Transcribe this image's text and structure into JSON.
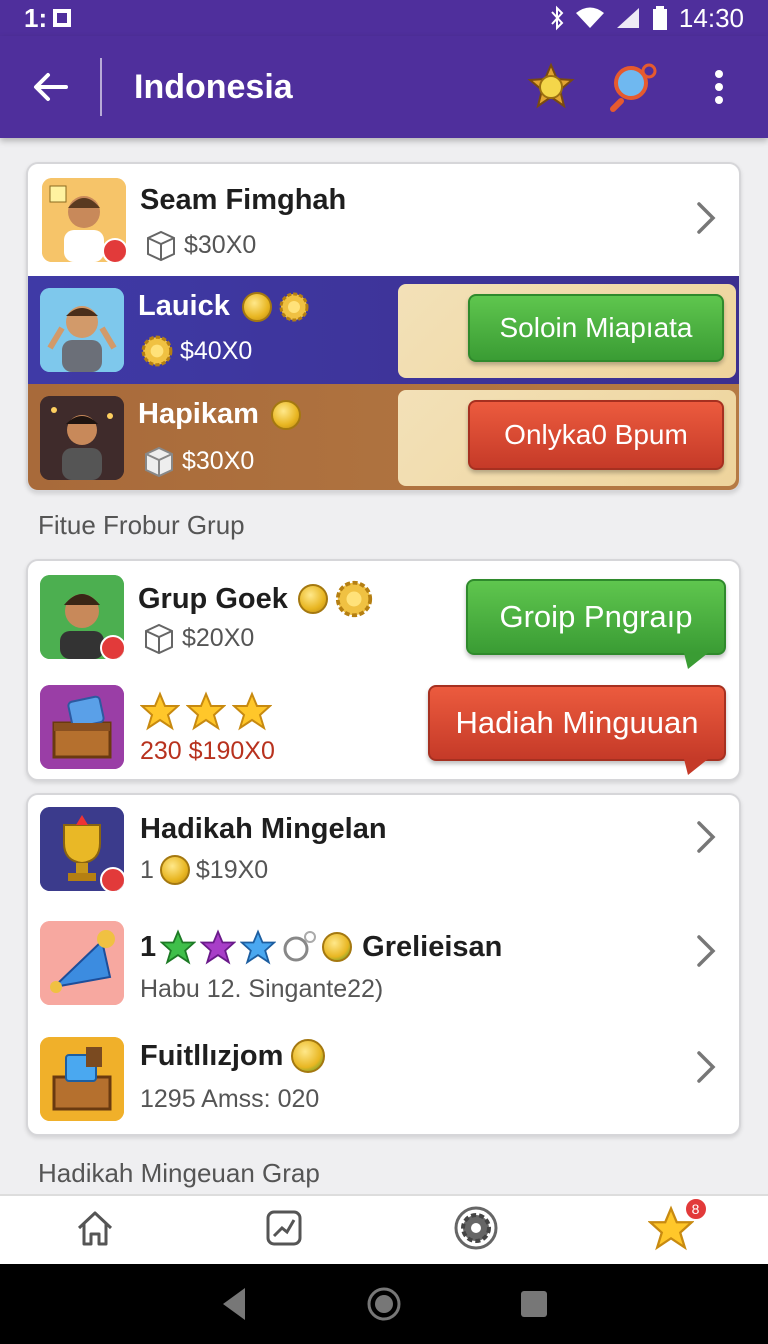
{
  "status_bar": {
    "time_left": "1:",
    "clock": "14:30"
  },
  "app_bar": {
    "title": "Indonesia"
  },
  "card1": {
    "rows": [
      {
        "name": "Seam Fimghah",
        "amount": "$30X0"
      },
      {
        "name": "Lauick",
        "amount": "$40X0",
        "button": "Soloin Miapıata"
      },
      {
        "name": "Hapikam",
        "amount": "$30X0",
        "button": "Onlyka0 Bpum"
      }
    ]
  },
  "section1": "Fitue Frobur Grup",
  "card2": {
    "rows": [
      {
        "name": "Grup Goek",
        "amount": "$20X0",
        "button": "Groip Pngraıp"
      },
      {
        "amount": "230 $190X0",
        "button": "Hadiah Minguuan"
      }
    ]
  },
  "card3": {
    "rows": [
      {
        "name": "Hadikah Mingelan",
        "amount": "$19X0",
        "prefix": "1"
      },
      {
        "prefix": "1",
        "name": "Grelieisan",
        "sub": "Habu 12. Singante22)"
      },
      {
        "name": "Fuitllızjom",
        "sub": "1295 Amss: 020"
      }
    ]
  },
  "section2": "Hadikah Mingeuan Grap",
  "bottom_nav": {
    "badge": "8"
  },
  "colors": {
    "primary": "#4f2f9c",
    "green": "#3a9c34",
    "red": "#c53a28",
    "row_blue": "#3f3aa6",
    "row_brown": "#a86a3a"
  }
}
